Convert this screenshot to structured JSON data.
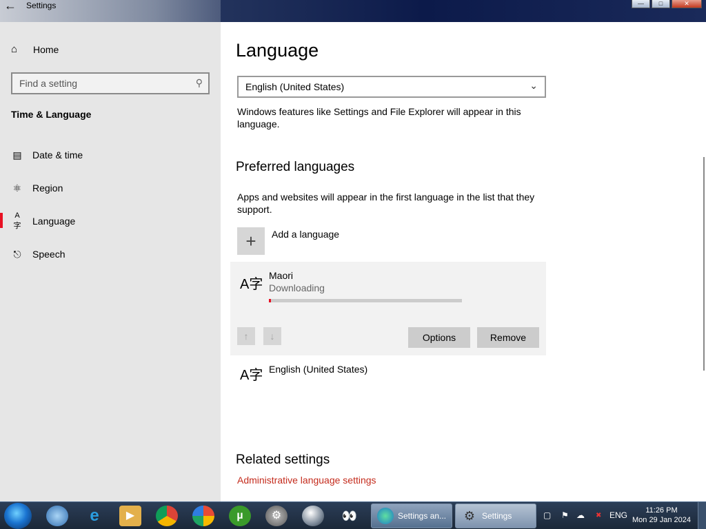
{
  "window": {
    "title": "Settings"
  },
  "sidebar": {
    "home_label": "Home",
    "search_placeholder": "Find a setting",
    "section_title": "Time & Language",
    "items": [
      {
        "label": "Date & time",
        "icon": "calendar-clock-icon"
      },
      {
        "label": "Region",
        "icon": "globe-icon"
      },
      {
        "label": "Language",
        "icon": "language-icon",
        "active": true
      },
      {
        "label": "Speech",
        "icon": "microphone-icon"
      }
    ]
  },
  "main": {
    "title": "Language",
    "display_language": {
      "selected": "English (United States)",
      "description": "Windows features like Settings and File Explorer will appear in this language."
    },
    "preferred": {
      "title": "Preferred languages",
      "description": "Apps and websites will appear in the first language in the list that they support.",
      "add_label": "Add a language",
      "languages": [
        {
          "name": "Maori",
          "status": "Downloading",
          "progress_fraction": 0.01
        },
        {
          "name": "English (United States)"
        }
      ],
      "options_label": "Options",
      "remove_label": "Remove"
    },
    "related": {
      "title": "Related settings",
      "link": "Administrative language settings"
    }
  },
  "taskbar": {
    "tasks": [
      {
        "label": "Settings an..."
      },
      {
        "label": "Settings"
      }
    ],
    "tray": {
      "lang": "ENG",
      "time": "11:26 PM",
      "date": "Mon 29 Jan 2024"
    }
  },
  "colors": {
    "accent": "#e81123",
    "link": "#c42b1c"
  }
}
